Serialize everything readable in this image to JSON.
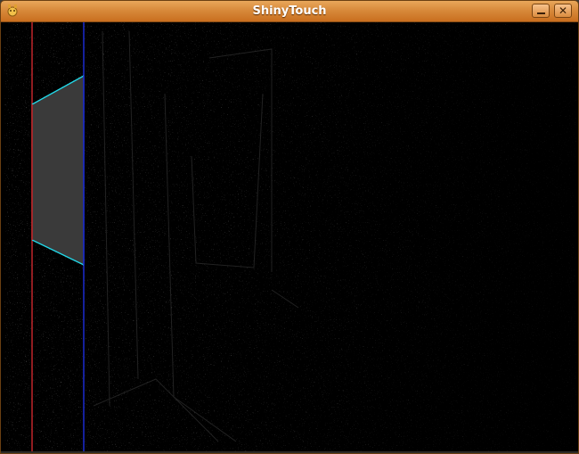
{
  "window": {
    "title": "ShinyTouch",
    "title_color": "#ffffff",
    "titlebar_color": "#d88a3b"
  },
  "controls": {
    "minimize_icon": "minimize-icon",
    "close_icon": "close-icon",
    "close_glyph": "✕"
  },
  "canvas": {
    "background": "#000000",
    "left_guide_color": "#c0262a",
    "right_guide_color": "#1a2ad0",
    "region_fill": "#3a3a3a",
    "region_edge_color": "#22d8e8"
  }
}
